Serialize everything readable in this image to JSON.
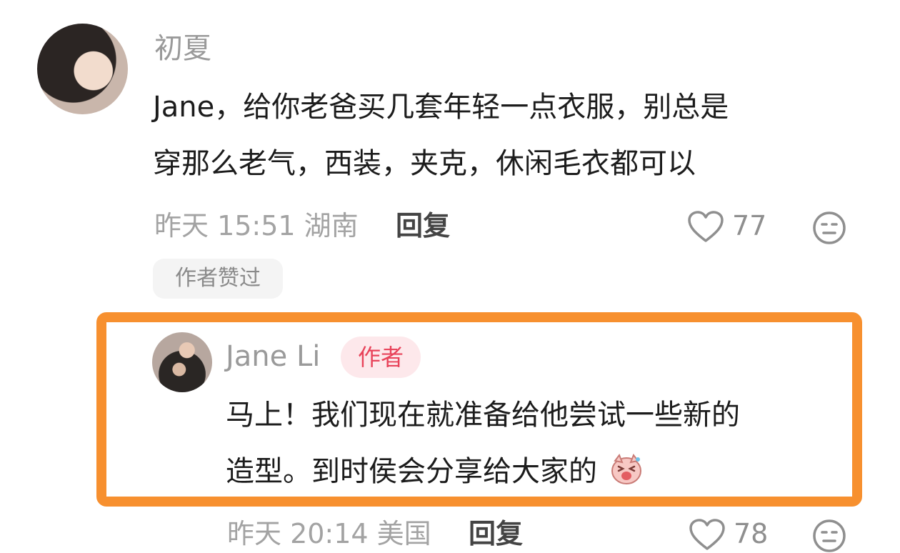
{
  "comment1": {
    "name": "初夏",
    "text_line1": "Jane，给你老爸买几套年轻一点衣服，别总是",
    "text_line2": "穿那么老气，西装，夹克，休闲毛衣都可以",
    "time_location": "昨天 15:51 湖南",
    "reply_label": "回复",
    "likes": "77",
    "author_liked_badge": "作者赞过"
  },
  "reply1": {
    "name": "Jane Li",
    "author_tag": "作者",
    "text_line1": "马上！我们现在就准备给他尝试一些新的",
    "text_line2": "造型。到时侯会分享给大家的",
    "emoji": "pig-face-emoji",
    "time_location": "昨天 20:14 美国",
    "reply_label": "回复",
    "likes": "78"
  },
  "colors": {
    "highlight_border": "#f7902f",
    "author_tag_text": "#e8435a",
    "author_tag_bg": "#fde8eb"
  }
}
